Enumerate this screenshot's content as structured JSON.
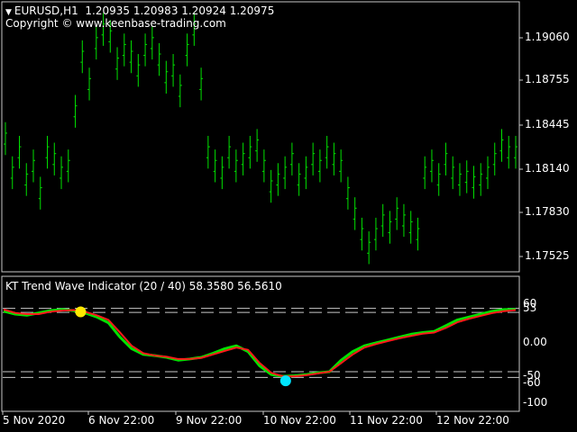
{
  "header": {
    "symbol": "EURUSD,H1",
    "ohlc": "1.20935 1.20983 1.20924 1.20975",
    "copyright": "Copyright © www.keenbase-trading.com"
  },
  "price_axis": {
    "labels": [
      "1.19060",
      "1.18755",
      "1.18445",
      "1.18140",
      "1.17830",
      "1.17525"
    ]
  },
  "indicator": {
    "title": "KT Trend Wave Indicator (20 / 40) 58.3580 56.5610",
    "axis_labels": [
      "60",
      "53",
      "0.00",
      "-50",
      "-60",
      "-100"
    ],
    "signal_colors": {
      "fast": "#00e000",
      "slow": "#ff1a1a",
      "buy": "#00e5ff",
      "sell": "#ffe800"
    }
  },
  "time_axis": {
    "labels": [
      "5 Nov 2020",
      "6 Nov 22:00",
      "9 Nov 22:00",
      "10 Nov 22:00",
      "11 Nov 22:00",
      "12 Nov 22:00"
    ]
  },
  "chart_data": {
    "type": "line",
    "price_series": [
      1.184,
      1.1815,
      1.183,
      1.181,
      1.182,
      1.18,
      1.183,
      1.1825,
      1.1815,
      1.182,
      1.186,
      1.19,
      1.188,
      1.191,
      1.192,
      1.1915,
      1.1895,
      1.1905,
      1.19,
      1.189,
      1.1905,
      1.191,
      1.1898,
      1.1885,
      1.189,
      1.1875,
      1.1905,
      1.192,
      1.188,
      1.183,
      1.182,
      1.1815,
      1.183,
      1.182,
      1.1825,
      1.183,
      1.1835,
      1.182,
      1.1805,
      1.181,
      1.1815,
      1.1825,
      1.181,
      1.1815,
      1.1825,
      1.182,
      1.183,
      1.1825,
      1.182,
      1.18,
      1.1785,
      1.177,
      1.176,
      1.177,
      1.178,
      1.1775,
      1.1785,
      1.178,
      1.1775,
      1.177,
      1.1815,
      1.182,
      1.181,
      1.1825,
      1.1815,
      1.181,
      1.1812,
      1.1808,
      1.181,
      1.1815,
      1.1825,
      1.1835,
      1.183,
      1.183
    ],
    "wave_fast": [
      55,
      50,
      48,
      52,
      56,
      58,
      56,
      52,
      45,
      35,
      10,
      -10,
      -20,
      -22,
      -25,
      -30,
      -28,
      -25,
      -18,
      -10,
      -5,
      -15,
      -40,
      -55,
      -58,
      -57,
      -55,
      -52,
      -50,
      -30,
      -15,
      -5,
      0,
      5,
      10,
      15,
      18,
      20,
      30,
      40,
      45,
      50,
      55,
      58,
      58
    ],
    "wave_slow": [
      58,
      52,
      50,
      50,
      54,
      56,
      57,
      54,
      48,
      40,
      18,
      -5,
      -18,
      -22,
      -24,
      -28,
      -28,
      -26,
      -20,
      -14,
      -8,
      -12,
      -35,
      -52,
      -58,
      -58,
      -56,
      -53,
      -50,
      -35,
      -20,
      -8,
      -2,
      3,
      8,
      12,
      16,
      18,
      26,
      36,
      42,
      47,
      52,
      55,
      57
    ],
    "yellow_dot_index": 6,
    "cyan_dot_index": 24
  }
}
